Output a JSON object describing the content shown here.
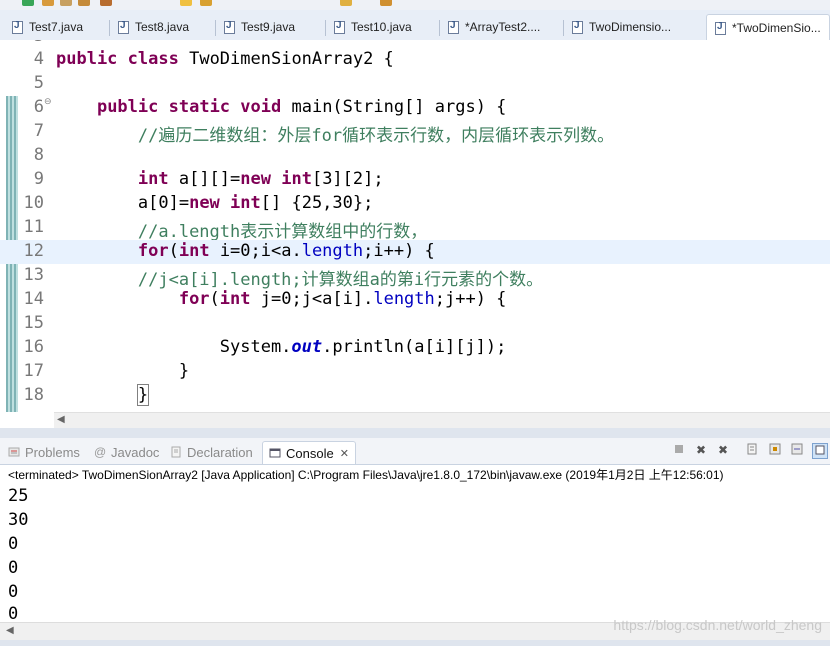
{
  "editor_tabs": [
    {
      "label": "Test7.java",
      "active": false
    },
    {
      "label": "Test8.java",
      "active": false
    },
    {
      "label": "Test9.java",
      "active": false
    },
    {
      "label": "Test10.java",
      "active": false
    },
    {
      "label": "*ArrayTest2....",
      "active": false
    },
    {
      "label": "TwoDimensio...",
      "active": false
    },
    {
      "label": "*TwoDimenSio...",
      "active": true
    }
  ],
  "code": {
    "line_numbers": [
      "4",
      "5",
      "6",
      "7",
      "8",
      "9",
      "10",
      "11",
      "12",
      "13",
      "14",
      "15",
      "16",
      "17",
      "18"
    ],
    "fold_marker": "⊖",
    "line4": {
      "kw1": "public",
      "kw2": "class",
      "rest": " TwoDimenSionArray2 {"
    },
    "line6": {
      "kw1": "public",
      "kw2": "static",
      "kw3": "void",
      "rest": " main(String[] args) {"
    },
    "line7": {
      "comment": "//遍历二维数组：外层for循环表示行数，内层循环表示列数。"
    },
    "line9": {
      "kw": "int",
      "rest": " a[][]=",
      "kw2": "new",
      "kw3": "int",
      "rest2": "[3][2];"
    },
    "line10": {
      "pre": "a[0]=",
      "kw": "new",
      "kw2": "int",
      "rest": "[] {25,30};"
    },
    "line11": {
      "comment": "//a.length表示计算数组中的行数，"
    },
    "line12": {
      "kw": "for",
      "pre": "(",
      "kw2": "int",
      "mid": " i=0;i<a.",
      "field": "length",
      "rest": ";i++) {"
    },
    "line13": {
      "comment": "//j<a[i].length;计算数组a的第i行元素的个数。"
    },
    "line14": {
      "kw": "for",
      "pre": "(",
      "kw2": "int",
      "mid": " j=0;j<a[i].",
      "field": "length",
      "rest": ";j++) {"
    },
    "line16": {
      "pre": "System.",
      "static_field": "out",
      "rest": ".println(a[i][j]);"
    },
    "line17": {
      "text": "}"
    },
    "line18": {
      "text": "}"
    }
  },
  "views": {
    "tabs": [
      "Problems",
      "Javadoc",
      "Declaration",
      "Console"
    ],
    "active": "Console",
    "close_glyph": "✕"
  },
  "console": {
    "header": "<terminated> TwoDimenSionArray2 [Java Application] C:\\Program Files\\Java\\jre1.8.0_172\\bin\\javaw.exe (2019年1月2日 上午12:56:01)",
    "output": [
      "25",
      "30",
      "0",
      "0",
      "0",
      "0"
    ]
  },
  "watermark": "https://blog.csdn.net/world_zheng",
  "colors": {
    "keyword": "#7f0055",
    "comment": "#3f7f5f",
    "field": "#0000c0",
    "current_line": "#e8f2fe"
  }
}
